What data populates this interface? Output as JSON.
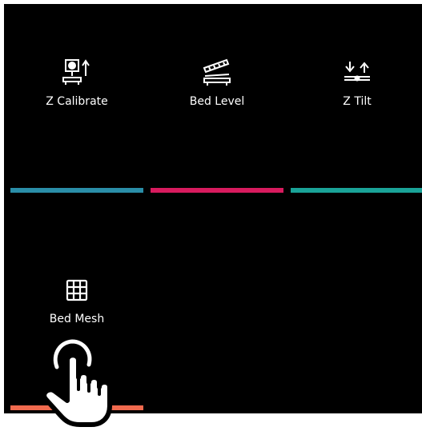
{
  "menu": {
    "tiles": [
      {
        "label": "Z Calibrate",
        "icon": "z-calibrate-icon",
        "accent": "#2a8ea8"
      },
      {
        "label": "Bed Level",
        "icon": "bed-level-icon",
        "accent": "#d81b5e"
      },
      {
        "label": "Z Tilt",
        "icon": "z-tilt-icon",
        "accent": "#1aa398"
      },
      {
        "label": "Bed Mesh",
        "icon": "grid-icon",
        "accent": "#f06a4e"
      }
    ]
  },
  "overlay": {
    "icon": "tap-hand-icon"
  }
}
